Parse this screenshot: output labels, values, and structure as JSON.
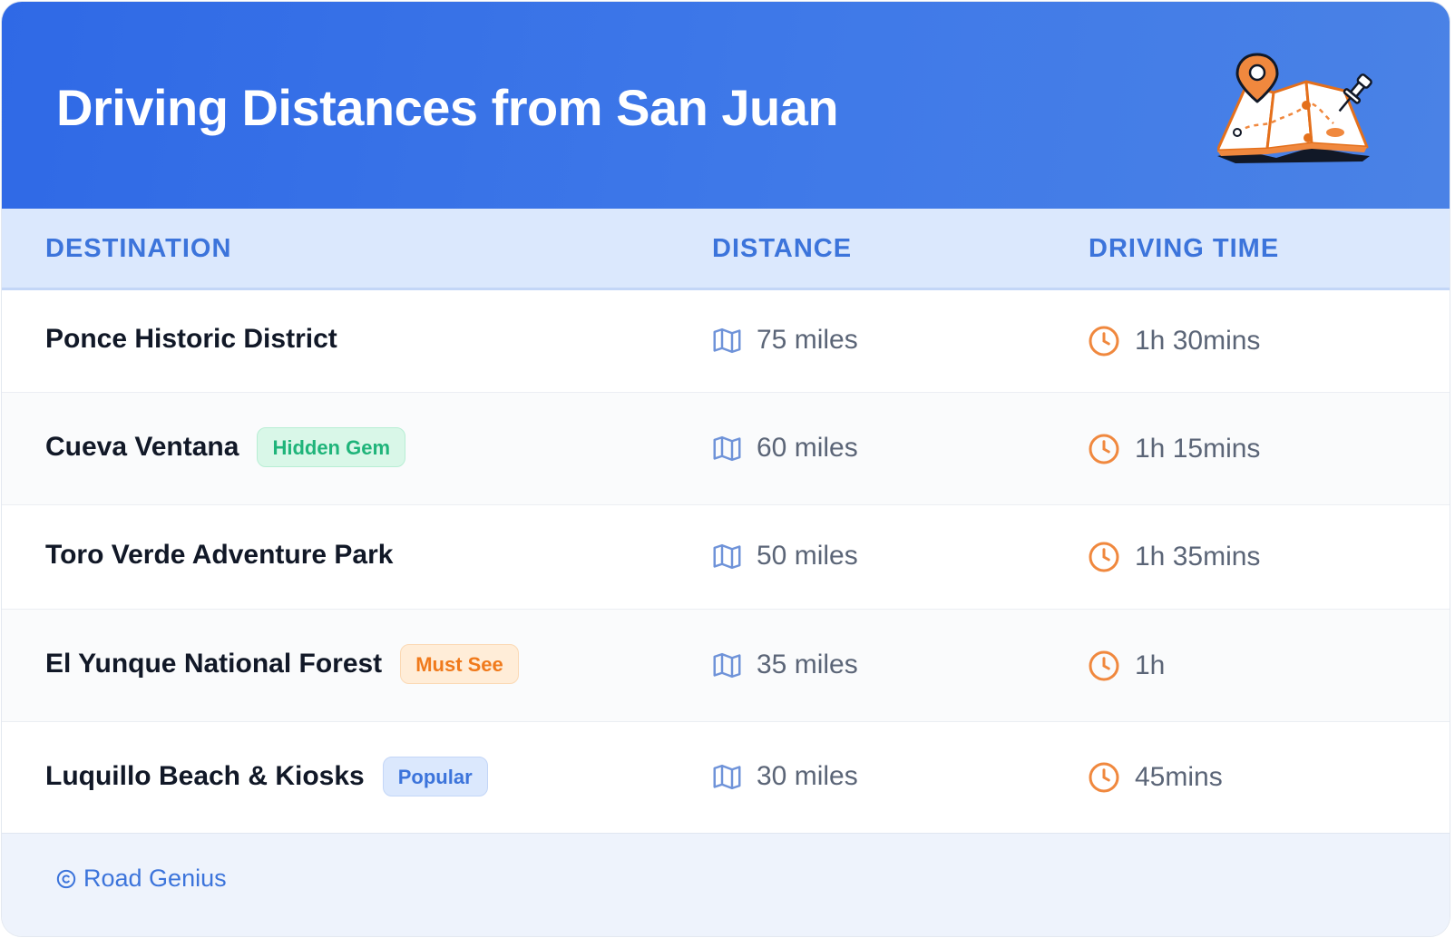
{
  "header": {
    "title": "Driving Distances from San Juan"
  },
  "columns": {
    "destination": "DESTINATION",
    "distance": "DISTANCE",
    "driving_time": "DRIVING TIME"
  },
  "rows": [
    {
      "destination": "Ponce Historic District",
      "badge": "",
      "distance": "75 miles",
      "time": "1h 30mins"
    },
    {
      "destination": "Cueva Ventana",
      "badge": "Hidden Gem",
      "badge_style": "green",
      "distance": "60 miles",
      "time": "1h 15mins"
    },
    {
      "destination": "Toro Verde Adventure Park",
      "badge": "",
      "distance": "50 miles",
      "time": "1h 35mins"
    },
    {
      "destination": "El Yunque National Forest",
      "badge": "Must See",
      "badge_style": "orange",
      "distance": "35 miles",
      "time": "1h"
    },
    {
      "destination": "Luquillo Beach & Kiosks",
      "badge": "Popular",
      "badge_style": "blue",
      "distance": "30 miles",
      "time": "45mins"
    }
  ],
  "footer": {
    "credit": "Road Genius"
  },
  "colors": {
    "header_blue": "#2f69e6",
    "accent_blue": "#3c74db",
    "accent_orange": "#f07a1c",
    "icon_map": "#6f93d9",
    "icon_clock": "#f0883e"
  },
  "icons": {
    "distance": "map-icon",
    "time": "clock-icon",
    "header": "map-pin-illustration"
  }
}
